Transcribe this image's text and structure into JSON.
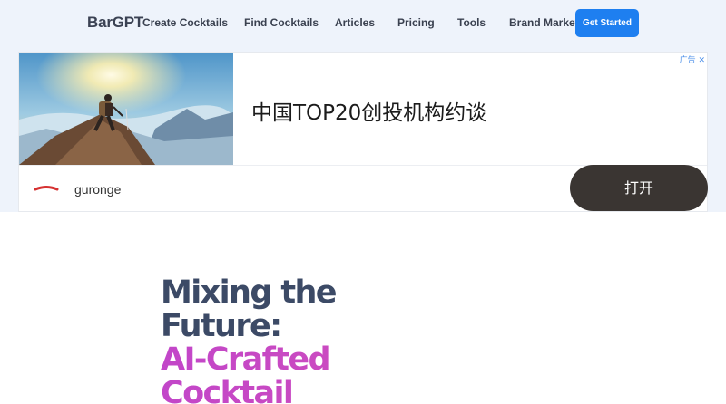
{
  "nav": {
    "logo": "BarGPT",
    "links": [
      "Create Cocktails",
      "Find Cocktails",
      "Articles",
      "Pricing",
      "Tools",
      "Brand Marketing"
    ],
    "cta": "Get Started"
  },
  "ad": {
    "headline": "中国TOP20创投机构约谈",
    "mark": "广告 ✕",
    "brand": "guronge",
    "open_button": "打开"
  },
  "hero": {
    "line1": "Mixing the",
    "line2": "Future:",
    "line3": "AI-Crafted",
    "line4": "Cocktail"
  },
  "colors": {
    "accent": "#1e7ff0",
    "hero_dark": "#3c4a66",
    "hero_gradient_start": "#c246c9",
    "ad_button": "#3a3532"
  }
}
